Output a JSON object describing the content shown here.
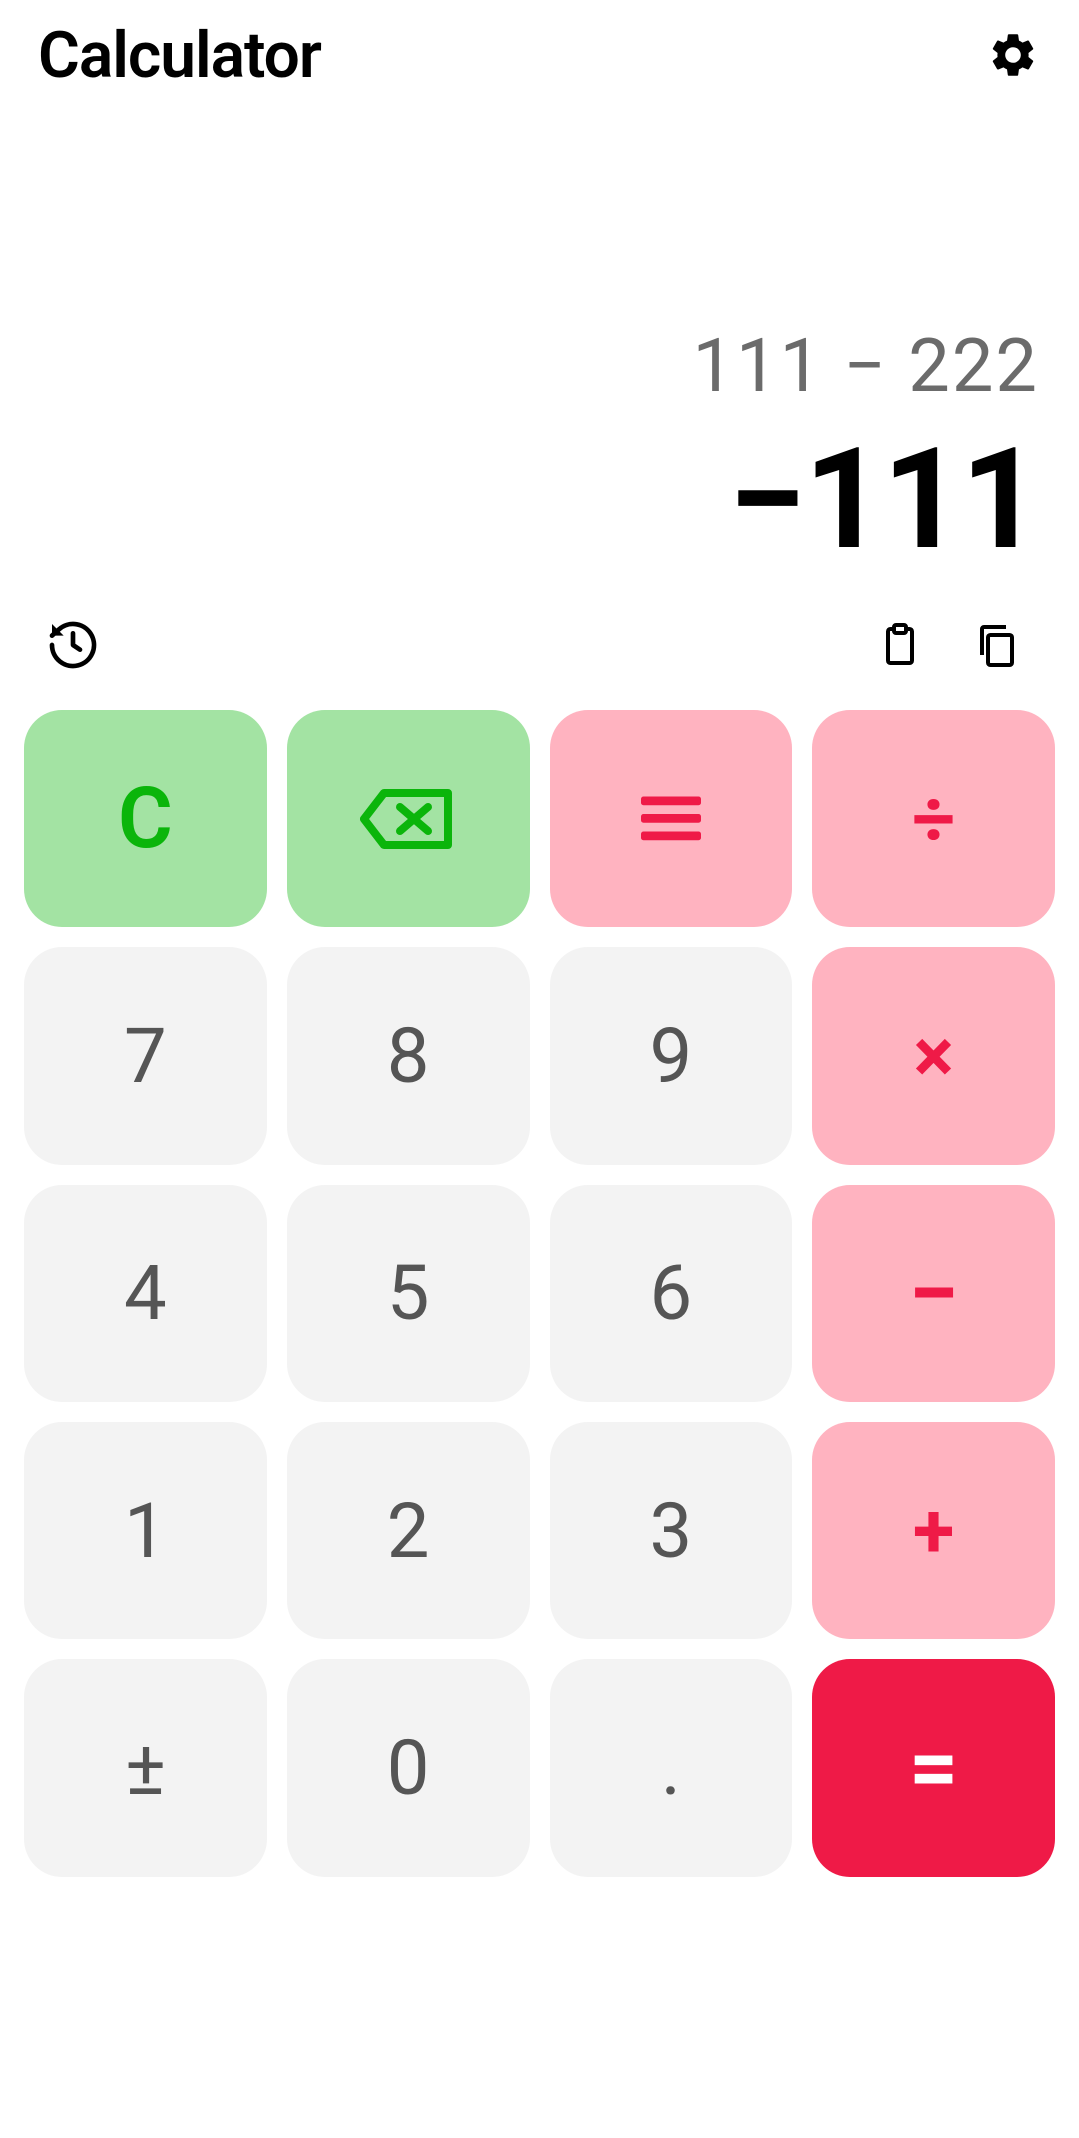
{
  "header": {
    "title": "Calculator"
  },
  "display": {
    "expression": "111 − 222",
    "result": "−111"
  },
  "keys": {
    "clear": "C",
    "seven": "7",
    "eight": "8",
    "nine": "9",
    "multiply": "×",
    "four": "4",
    "five": "5",
    "six": "6",
    "minus": "−",
    "one": "1",
    "two": "2",
    "three": "3",
    "plus": "+",
    "plusminus": "±",
    "zero": "0",
    "decimal": ".",
    "divide": "÷",
    "equals": "="
  }
}
